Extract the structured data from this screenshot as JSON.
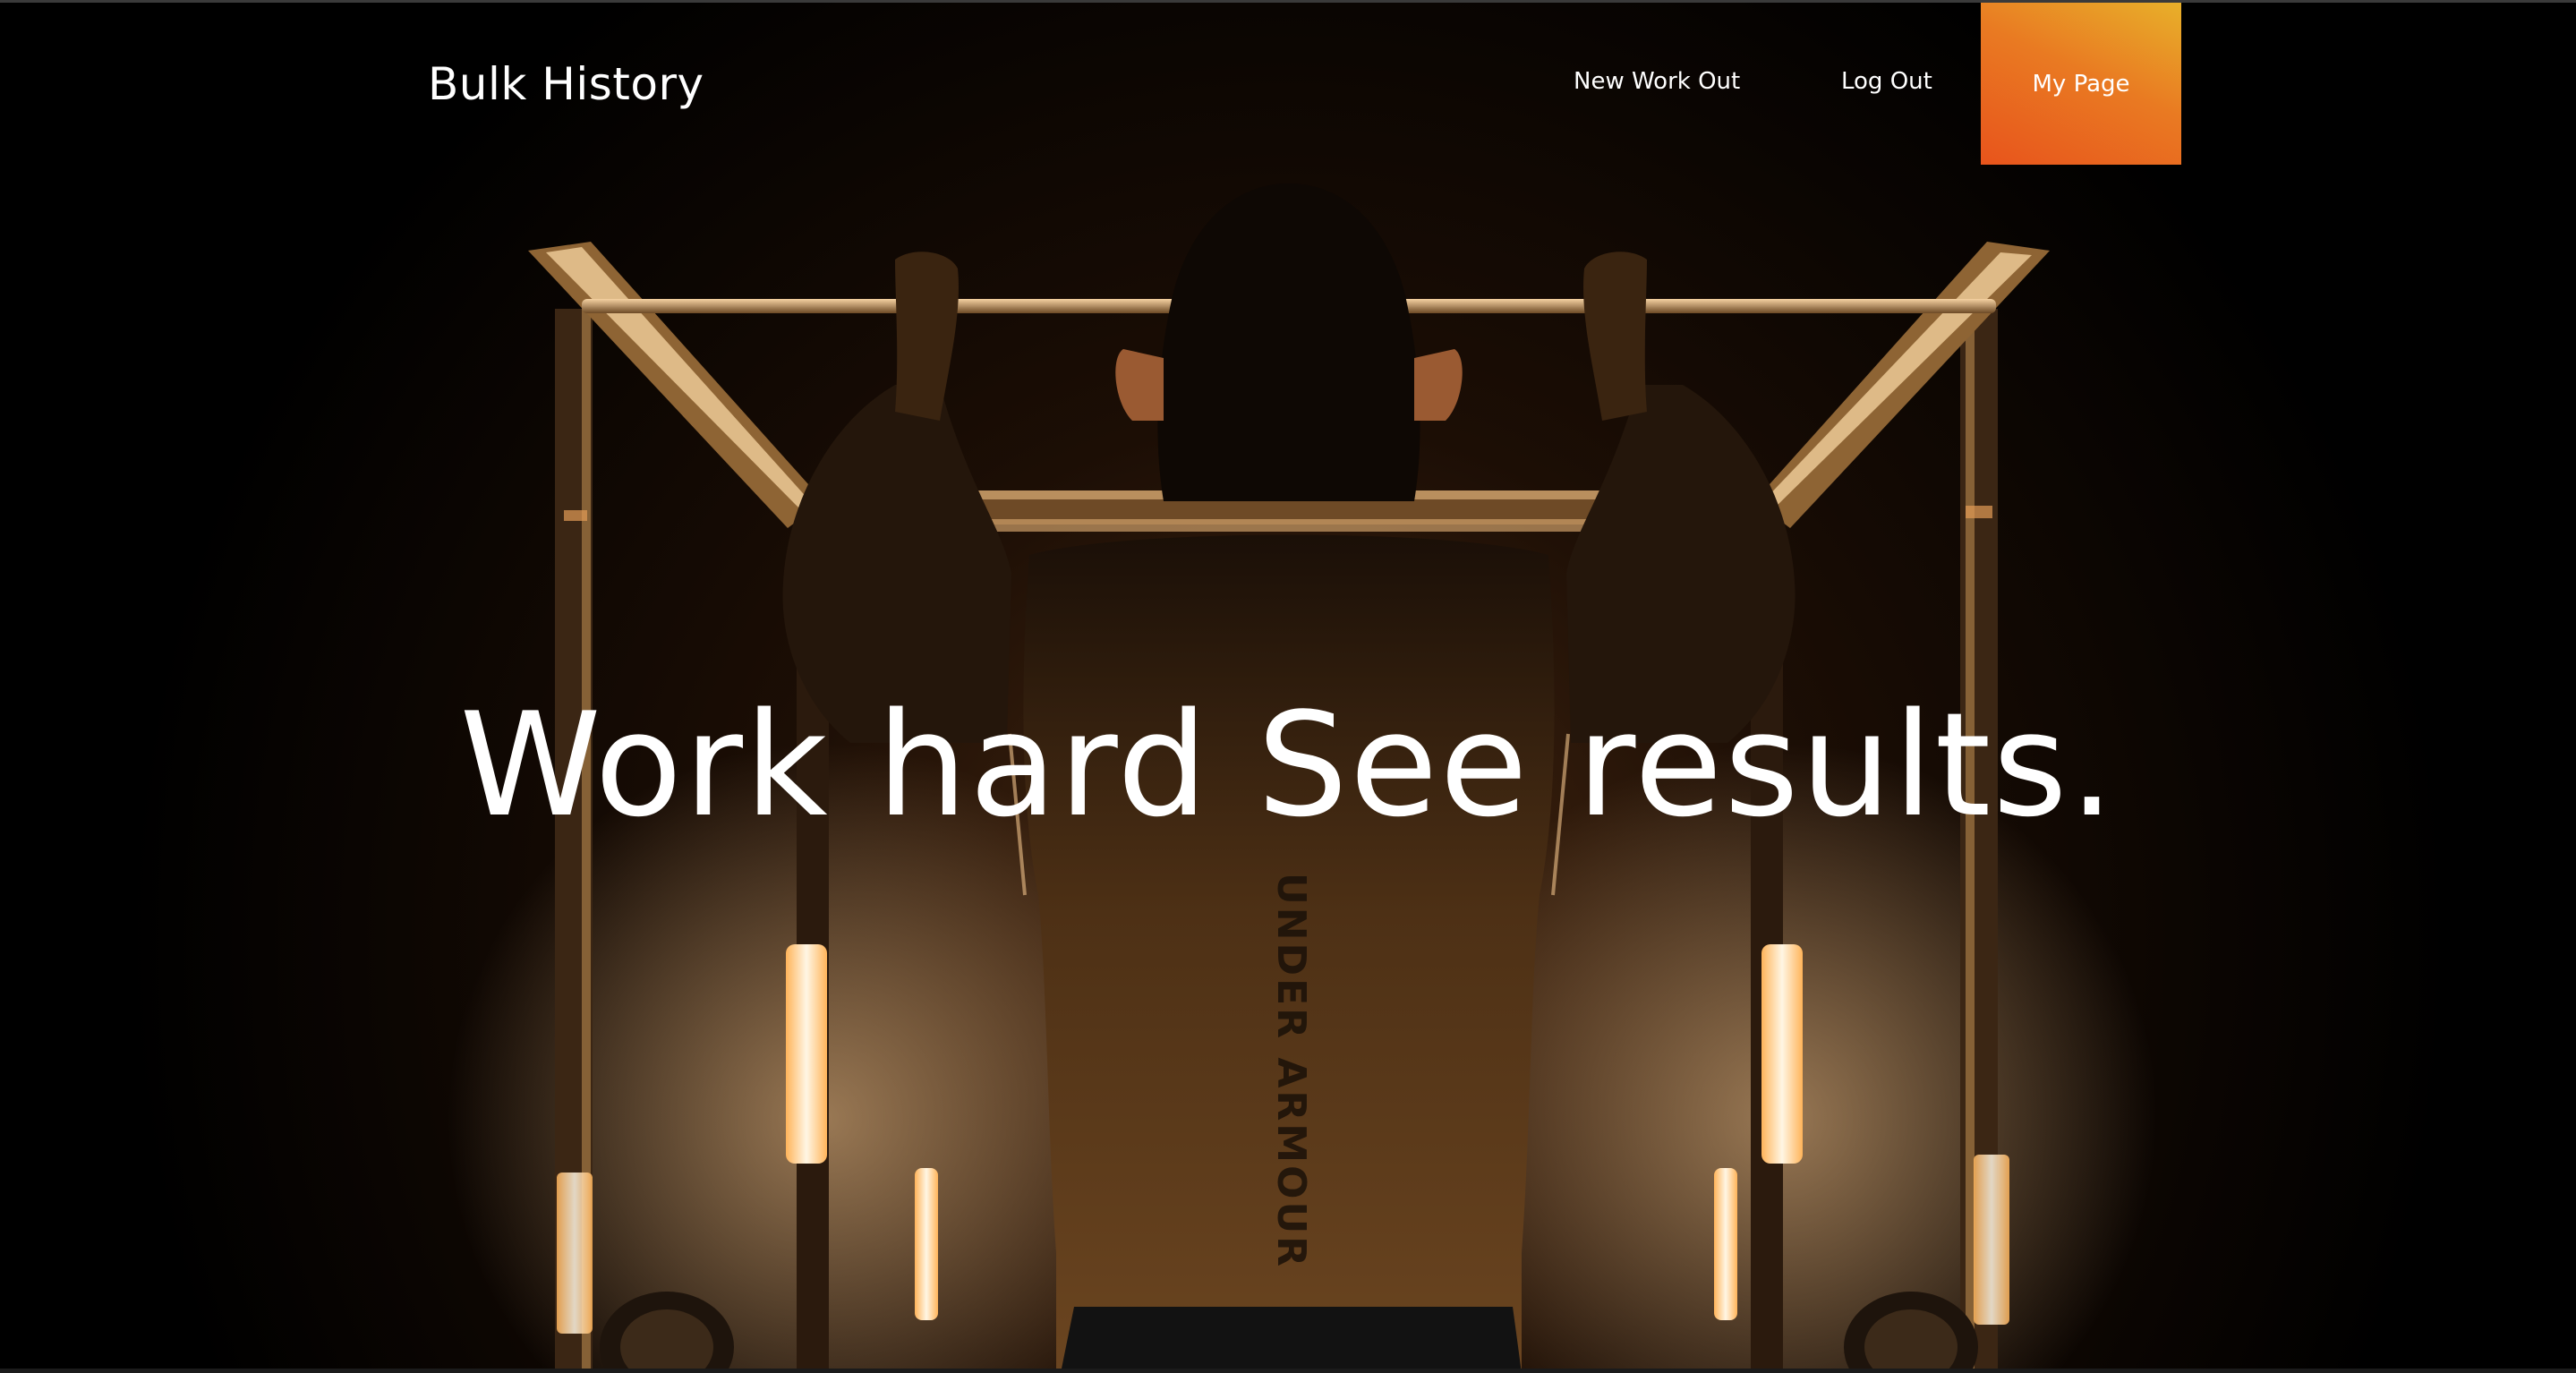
{
  "brand": {
    "title": "Bulk History"
  },
  "nav": {
    "items": [
      {
        "label": "New Work Out"
      },
      {
        "label": "Log Out"
      },
      {
        "label": "My Page"
      }
    ]
  },
  "hero": {
    "headline": "Work hard See results.",
    "shirt_text": "UNDER ARMOUR"
  },
  "colors": {
    "accent_start": "#e8541c",
    "accent_end": "#e8b02a",
    "background": "#000000",
    "text": "#ffffff",
    "glow": "#ffb870"
  }
}
